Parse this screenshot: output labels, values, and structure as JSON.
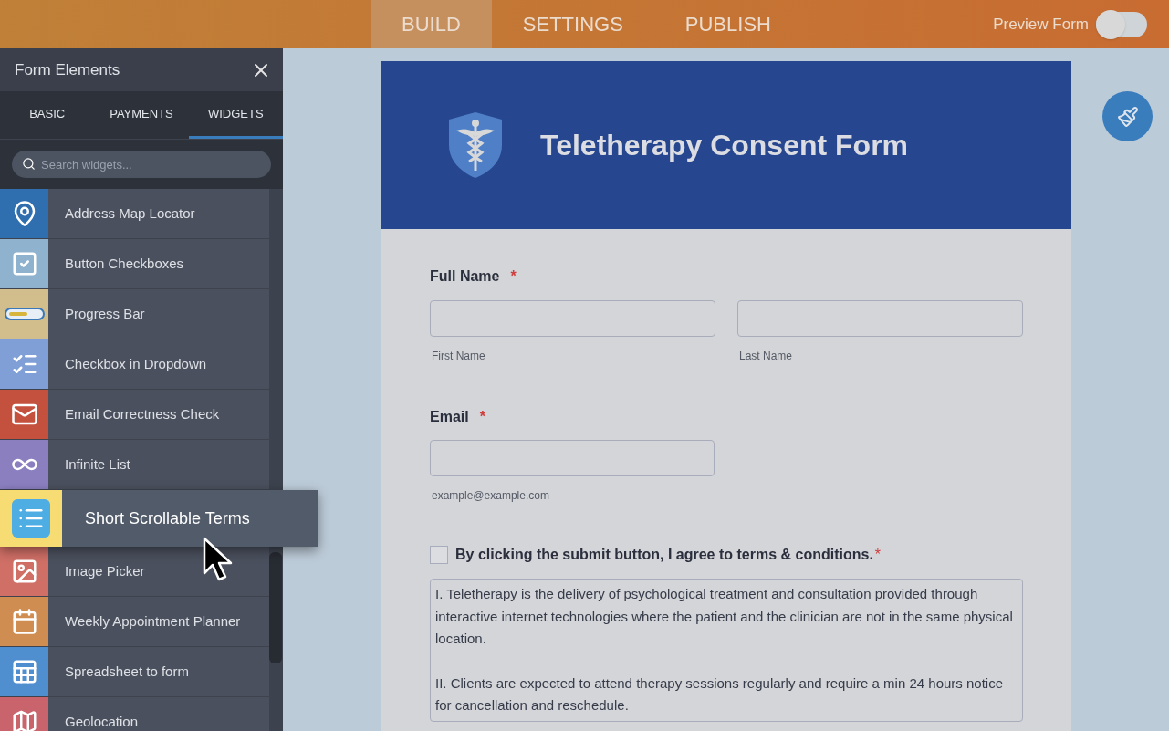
{
  "topbar": {
    "tabs": [
      {
        "label": "BUILD",
        "selected": true
      },
      {
        "label": "SETTINGS",
        "selected": false
      },
      {
        "label": "PUBLISH",
        "selected": false
      }
    ],
    "preview": {
      "label": "Preview Form",
      "on": false
    }
  },
  "sidebar": {
    "title": "Form Elements",
    "tabs": [
      {
        "label": "BASIC",
        "selected": false
      },
      {
        "label": "PAYMENTS",
        "selected": false
      },
      {
        "label": "WIDGETS",
        "selected": true
      }
    ],
    "search": {
      "placeholder": "Search widgets..."
    },
    "items": [
      {
        "label": "Address Map Locator",
        "kind": "map",
        "color": "#2f6fb0",
        "dragging": false
      },
      {
        "label": "Button Checkboxes",
        "kind": "checkboxes",
        "color": "#8fb2cf",
        "dragging": false
      },
      {
        "label": "Progress Bar",
        "kind": "progress",
        "color": "#d2bd8c",
        "dragging": false
      },
      {
        "label": "Checkbox in Dropdown",
        "kind": "checklist",
        "color": "#7f9fd6",
        "dragging": false
      },
      {
        "label": "Email Correctness Check",
        "kind": "mail",
        "color": "#c4503e",
        "dragging": false
      },
      {
        "label": "Infinite List",
        "kind": "infinity",
        "color": "#8b7fc0",
        "dragging": false
      },
      {
        "label": "Short Scrollable Terms",
        "kind": "list",
        "color": "#f7dc73",
        "dragging": true
      },
      {
        "label": "Image Picker",
        "kind": "image",
        "color": "#cf6f66",
        "dragging": false
      },
      {
        "label": "Weekly Appointment Planner",
        "kind": "calendar",
        "color": "#cf8d51",
        "dragging": false
      },
      {
        "label": "Spreadsheet to form",
        "kind": "spreadsheet",
        "color": "#4f8fd0",
        "dragging": false
      },
      {
        "label": "Geolocation",
        "kind": "geolocation",
        "color": "#c9646d",
        "dragging": false
      }
    ]
  },
  "form": {
    "title": "Teletherapy Consent Form",
    "full_name": {
      "label": "Full Name",
      "required": "*",
      "fields": [
        {
          "sublabel": "First Name"
        },
        {
          "sublabel": "Last Name"
        }
      ]
    },
    "email": {
      "label": "Email",
      "required": "*",
      "sublabel": "example@example.com"
    },
    "terms": {
      "checked": false,
      "label": "By clicking the submit button, I agree to terms & conditions.",
      "required": "*",
      "paragraphs": [
        "I. Teletherapy is the delivery of psychological treatment and consultation provided through interactive internet technologies where the patient and the clinician are not in the same physical location.",
        "II. Clients are expected to attend therapy sessions regularly and require a min 24 hours notice for cancellation and reschedule."
      ]
    }
  }
}
